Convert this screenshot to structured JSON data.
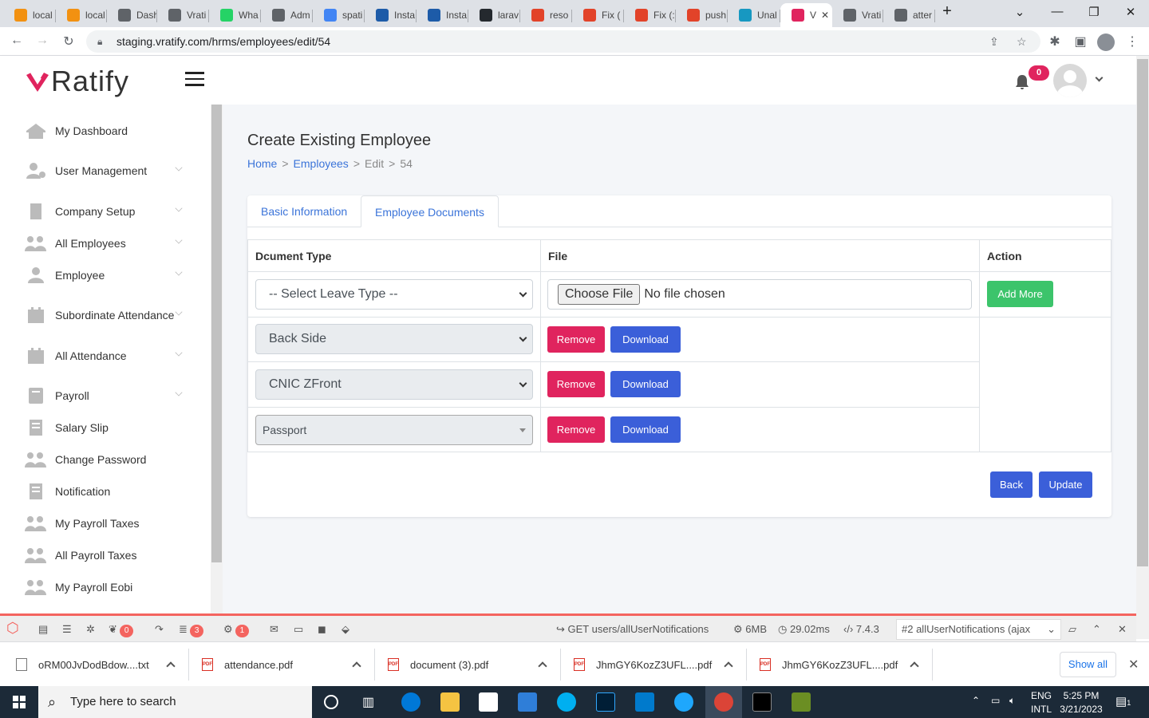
{
  "browser": {
    "tabs": [
      {
        "label": "local",
        "icon": "pma-icon",
        "color": "#f29111"
      },
      {
        "label": "local",
        "icon": "pma-icon",
        "color": "#f29111"
      },
      {
        "label": "Dash",
        "icon": "globe-icon",
        "color": "#5f6368"
      },
      {
        "label": "Vrati",
        "icon": "globe-icon",
        "color": "#5f6368"
      },
      {
        "label": "Wha",
        "icon": "whatsapp-icon",
        "color": "#25d366"
      },
      {
        "label": "Adm",
        "icon": "globe-icon",
        "color": "#5f6368"
      },
      {
        "label": "spati",
        "icon": "google-icon",
        "color": "#4285f4"
      },
      {
        "label": "Insta",
        "icon": "s-icon",
        "color": "#1d5ba8"
      },
      {
        "label": "Insta",
        "icon": "s-icon",
        "color": "#1d5ba8"
      },
      {
        "label": "larav",
        "icon": "github-icon",
        "color": "#24292e"
      },
      {
        "label": "reso",
        "icon": "gitlab-icon",
        "color": "#e24329"
      },
      {
        "label": "Fix (",
        "icon": "gitlab-icon",
        "color": "#e24329"
      },
      {
        "label": "Fix (:",
        "icon": "gitlab-icon",
        "color": "#e24329"
      },
      {
        "label": "push",
        "icon": "gitlab-icon",
        "color": "#e24329"
      },
      {
        "label": "Unal",
        "icon": "cloud-icon",
        "color": "#1798c1"
      },
      {
        "label": "V",
        "icon": "vratify-icon",
        "color": "#e0245e"
      },
      {
        "label": "Vrati",
        "icon": "globe-icon",
        "color": "#5f6368"
      },
      {
        "label": "atter",
        "icon": "globe-icon",
        "color": "#5f6368"
      }
    ],
    "new_tab": "+",
    "url": "staging.vratify.com/hrms/employees/edit/54"
  },
  "header": {
    "logo_text": "Ratify",
    "notification_count": "0"
  },
  "sidebar": {
    "items": [
      {
        "label": "My Dashboard",
        "icon": "home-icon",
        "chevron": false
      },
      {
        "label": "User Management",
        "icon": "user-cog-icon",
        "chevron": true
      },
      {
        "label": "Company Setup",
        "icon": "building-icon",
        "chevron": true
      },
      {
        "label": "All Employees",
        "icon": "users-icon",
        "chevron": true
      },
      {
        "label": "Employee",
        "icon": "user-icon",
        "chevron": true
      },
      {
        "label": "Subordinate Attendance",
        "icon": "calendar-icon",
        "chevron": true
      },
      {
        "label": "All Attendance",
        "icon": "calendar-icon",
        "chevron": true
      },
      {
        "label": "Payroll",
        "icon": "book-icon",
        "chevron": true
      },
      {
        "label": "Salary Slip",
        "icon": "receipt-icon",
        "chevron": false
      },
      {
        "label": "Change Password",
        "icon": "users-icon",
        "chevron": false
      },
      {
        "label": "Notification",
        "icon": "receipt-icon",
        "chevron": false
      },
      {
        "label": "My Payroll Taxes",
        "icon": "users-icon",
        "chevron": false
      },
      {
        "label": "All Payroll Taxes",
        "icon": "users-icon",
        "chevron": false
      },
      {
        "label": "My Payroll Eobi",
        "icon": "users-icon",
        "chevron": false
      }
    ]
  },
  "page": {
    "title": "Create Existing Employee",
    "breadcrumb": {
      "home": "Home",
      "sep1": ">",
      "employees": "Employees",
      "sep2": ">",
      "edit": "Edit",
      "sep3": ">",
      "id": "54"
    },
    "tabs": [
      "Basic Information",
      "Employee Documents"
    ],
    "active_tab": "Employee Documents",
    "table": {
      "headers": [
        "Dcument Type",
        "File",
        "Action"
      ],
      "new_row": {
        "select_placeholder": "-- Select Leave Type --",
        "choose_file": "Choose File",
        "no_file": "No file chosen",
        "add_more": "Add More"
      },
      "rows": [
        {
          "type": "Back Side",
          "remove": "Remove",
          "download": "Download"
        },
        {
          "type": "CNIC ZFront",
          "remove": "Remove",
          "download": "Download"
        },
        {
          "type": "Passport",
          "remove": "Remove",
          "download": "Download"
        }
      ]
    },
    "back_label": "Back",
    "update_label": "Update"
  },
  "debugbar": {
    "notifications_badge": "0",
    "queries_badge": "3",
    "models_badge": "1",
    "request": "GET users/allUserNotifications",
    "memory": "6MB",
    "time": "29.02ms",
    "php_version": "7.4.3",
    "request_select": "#2 allUserNotifications (ajax"
  },
  "downloads": {
    "items": [
      {
        "name": "oRM00JvDodBdow....txt",
        "type": "txt"
      },
      {
        "name": "attendance.pdf",
        "type": "pdf"
      },
      {
        "name": "document (3).pdf",
        "type": "pdf"
      },
      {
        "name": "JhmGY6KozZ3UFL....pdf",
        "type": "pdf"
      },
      {
        "name": "JhmGY6KozZ3UFL....pdf",
        "type": "pdf"
      }
    ],
    "show_all": "Show all"
  },
  "taskbar": {
    "search_placeholder": "Type here to search",
    "lang1": "ENG",
    "lang2": "INTL",
    "time": "5:25 PM",
    "date": "3/21/2023",
    "notif_count": "1"
  },
  "colors": {
    "brand_red": "#e0245e",
    "link_blue": "#3b74d9",
    "button_blue": "#3b5fd9",
    "button_green": "#3cc46b"
  }
}
